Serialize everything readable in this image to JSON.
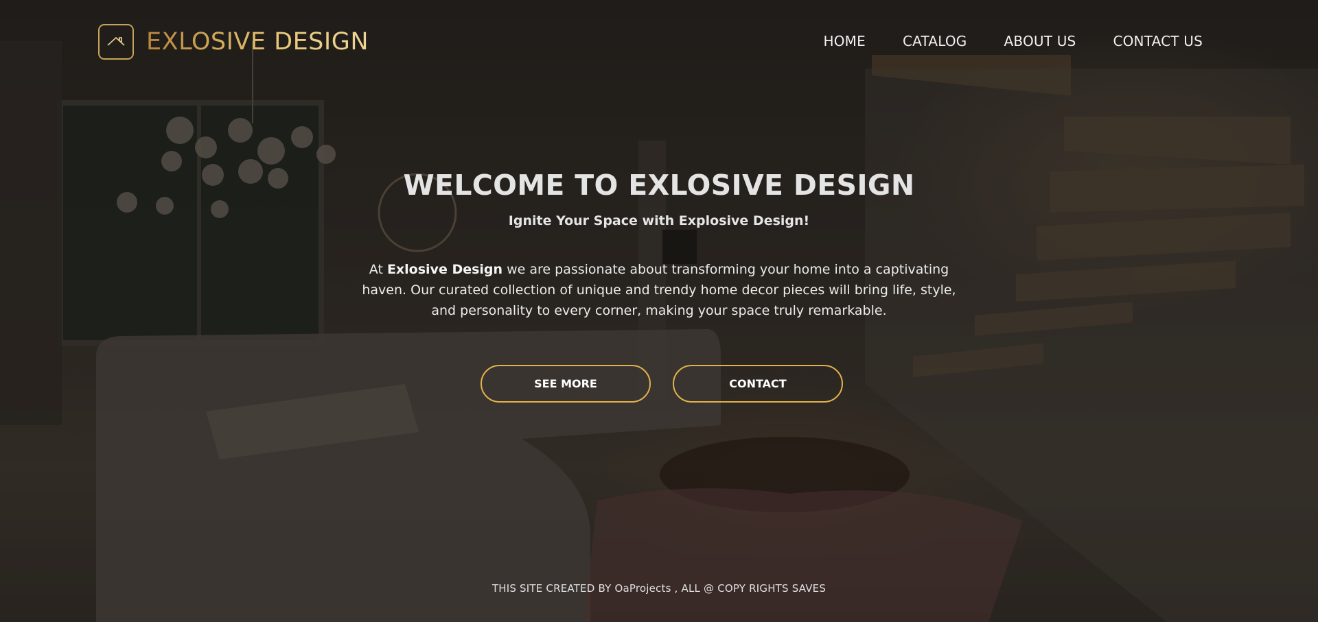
{
  "brand": {
    "name": "EXLOSIVE DESIGN",
    "logo_icon": "house-roof-icon",
    "accent_color": "#c7a35a"
  },
  "nav": {
    "items": [
      {
        "label": "HOME"
      },
      {
        "label": "CATALOG"
      },
      {
        "label": "ABOUT US"
      },
      {
        "label": "CONTACT US"
      }
    ]
  },
  "hero": {
    "title": "WELCOME TO EXLOSIVE DESIGN",
    "subtitle": "Ignite Your Space with Explosive Design!",
    "intro_prefix": "At ",
    "intro_brand": "Exlosive Design",
    "intro_rest": " we are passionate about transforming your home into a captivating haven. Our curated collection of unique and trendy home decor pieces will bring life, style, and personality to every corner, making your space truly remarkable.",
    "buttons": {
      "see_more": "SEE MORE",
      "contact": "CONTACT"
    },
    "button_border_color": "#e2b34a"
  },
  "footer": {
    "text": "THIS SITE CREATED BY OaProjects , ALL @ COPY RIGHTS SAVES"
  }
}
